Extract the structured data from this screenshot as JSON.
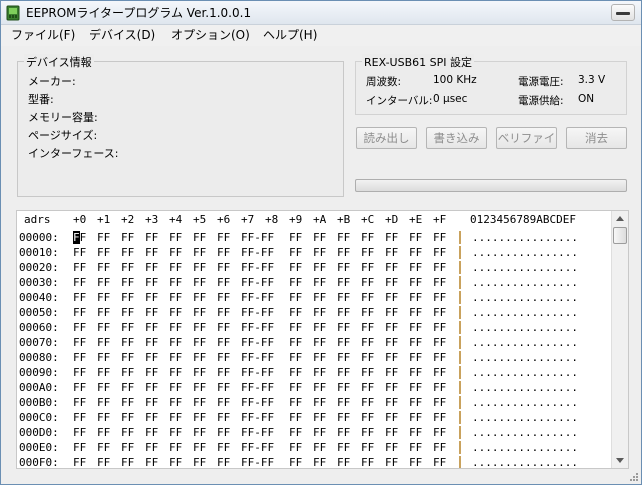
{
  "window": {
    "title": "EEPROMライタープログラム  Ver.1.0.0.1",
    "accent": "#3cb043"
  },
  "menu": [
    {
      "label": "ファイル(F)"
    },
    {
      "label": "デバイス(D)"
    },
    {
      "label": "オプション(O)"
    },
    {
      "label": "ヘルプ(H)"
    }
  ],
  "device_info": {
    "title": "デバイス情報",
    "labels": [
      "メーカー:",
      "型番:",
      "メモリー容量:",
      "ページサイズ:",
      "インターフェース:"
    ]
  },
  "spi": {
    "title": "REX-USB61 SPI 設定",
    "frequency_label": "周波数:",
    "frequency_value": "100 KHz",
    "interval_label": "インターバル:",
    "interval_value": "0 µsec",
    "voltage_label": "電源電圧:",
    "voltage_value": "3.3 V",
    "supply_label": "電源供給:",
    "supply_value": "ON"
  },
  "buttons": {
    "read": "読み出し",
    "write": "書き込み",
    "verify": "ベリファイ",
    "erase": "消去"
  },
  "progress": {
    "value": 0
  },
  "hex": {
    "header_addr": "adrs",
    "columns": [
      "+0",
      "+1",
      "+2",
      "+3",
      "+4",
      "+5",
      "+6",
      "+7",
      "+8",
      "+9",
      "+A",
      "+B",
      "+C",
      "+D",
      "+E",
      "+F"
    ],
    "ascii_header": "0123456789ABCDEF",
    "rows": [
      {
        "addr": "00000:",
        "ascii": "................"
      },
      {
        "addr": "00010:",
        "ascii": "................"
      },
      {
        "addr": "00020:",
        "ascii": "................"
      },
      {
        "addr": "00030:",
        "ascii": "................"
      },
      {
        "addr": "00040:",
        "ascii": "................"
      },
      {
        "addr": "00050:",
        "ascii": "................"
      },
      {
        "addr": "00060:",
        "ascii": "................"
      },
      {
        "addr": "00070:",
        "ascii": "................"
      },
      {
        "addr": "00080:",
        "ascii": "................"
      },
      {
        "addr": "00090:",
        "ascii": "................"
      },
      {
        "addr": "000A0:",
        "ascii": "................"
      },
      {
        "addr": "000B0:",
        "ascii": "................"
      },
      {
        "addr": "000C0:",
        "ascii": "................"
      },
      {
        "addr": "000D0:",
        "ascii": "................"
      },
      {
        "addr": "000E0:",
        "ascii": "................"
      },
      {
        "addr": "000F0:",
        "ascii": "................"
      }
    ],
    "byte_value": "FF",
    "byte_mid_value": "FF-FF",
    "cursor_char": "F"
  }
}
